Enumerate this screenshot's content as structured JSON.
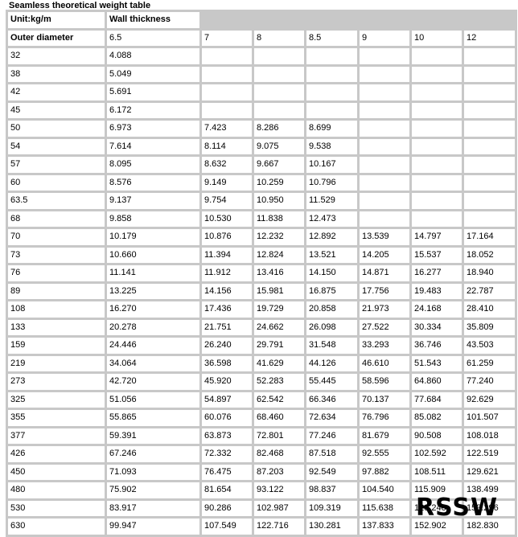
{
  "title": "Seamless theoretical weight table",
  "header": {
    "unit_label": "Unit:kg/m",
    "wall_label": "Wall thickness",
    "outer_label": "Outer diameter",
    "wall_values": [
      "6.5",
      "7",
      "8",
      "8.5",
      "9",
      "10",
      "12"
    ]
  },
  "rows": [
    {
      "od": "32",
      "v": [
        "4.088",
        "",
        "",
        "",
        "",
        "",
        ""
      ]
    },
    {
      "od": "38",
      "v": [
        "5.049",
        "",
        "",
        "",
        "",
        "",
        ""
      ]
    },
    {
      "od": "42",
      "v": [
        "5.691",
        "",
        "",
        "",
        "",
        "",
        ""
      ]
    },
    {
      "od": "45",
      "v": [
        "6.172",
        "",
        "",
        "",
        "",
        "",
        ""
      ]
    },
    {
      "od": "50",
      "v": [
        "6.973",
        "7.423",
        "8.286",
        "8.699",
        "",
        "",
        ""
      ]
    },
    {
      "od": "54",
      "v": [
        "7.614",
        "8.114",
        "9.075",
        "9.538",
        "",
        "",
        ""
      ]
    },
    {
      "od": "57",
      "v": [
        "8.095",
        "8.632",
        "9.667",
        "10.167",
        "",
        "",
        ""
      ]
    },
    {
      "od": "60",
      "v": [
        "8.576",
        "9.149",
        "10.259",
        "10.796",
        "",
        "",
        ""
      ]
    },
    {
      "od": "63.5",
      "v": [
        "9.137",
        "9.754",
        "10.950",
        "11.529",
        "",
        "",
        ""
      ]
    },
    {
      "od": "68",
      "v": [
        "9.858",
        "10.530",
        "11.838",
        "12.473",
        "",
        "",
        ""
      ]
    },
    {
      "od": "70",
      "v": [
        "10.179",
        "10.876",
        "12.232",
        "12.892",
        "13.539",
        "14.797",
        "17.164"
      ]
    },
    {
      "od": "73",
      "v": [
        "10.660",
        "11.394",
        "12.824",
        "13.521",
        "14.205",
        "15.537",
        "18.052"
      ]
    },
    {
      "od": "76",
      "v": [
        "11.141",
        "11.912",
        "13.416",
        "14.150",
        "14.871",
        "16.277",
        "18.940"
      ]
    },
    {
      "od": "89",
      "v": [
        "13.225",
        "14.156",
        "15.981",
        "16.875",
        "17.756",
        "19.483",
        "22.787"
      ]
    },
    {
      "od": "108",
      "v": [
        "16.270",
        "17.436",
        "19.729",
        "20.858",
        "21.973",
        "24.168",
        "28.410"
      ]
    },
    {
      "od": "133",
      "v": [
        "20.278",
        "21.751",
        "24.662",
        "26.098",
        "27.522",
        "30.334",
        "35.809"
      ]
    },
    {
      "od": "159",
      "v": [
        "24.446",
        "26.240",
        "29.791",
        "31.548",
        "33.293",
        "36.746",
        "43.503"
      ]
    },
    {
      "od": "219",
      "v": [
        "34.064",
        "36.598",
        "41.629",
        "44.126",
        "46.610",
        "51.543",
        "61.259"
      ]
    },
    {
      "od": "273",
      "v": [
        "42.720",
        "45.920",
        "52.283",
        "55.445",
        "58.596",
        "64.860",
        "77.240"
      ]
    },
    {
      "od": "325",
      "v": [
        "51.056",
        "54.897",
        "62.542",
        "66.346",
        "70.137",
        "77.684",
        "92.629"
      ]
    },
    {
      "od": "355",
      "v": [
        "55.865",
        "60.076",
        "68.460",
        "72.634",
        "76.796",
        "85.082",
        "101.507"
      ]
    },
    {
      "od": "377",
      "v": [
        "59.391",
        "63.873",
        "72.801",
        "77.246",
        "81.679",
        "90.508",
        "108.018"
      ]
    },
    {
      "od": "426",
      "v": [
        "67.246",
        "72.332",
        "82.468",
        "87.518",
        "92.555",
        "102.592",
        "122.519"
      ]
    },
    {
      "od": "450",
      "v": [
        "71.093",
        "76.475",
        "87.203",
        "92.549",
        "97.882",
        "108.511",
        "129.621"
      ]
    },
    {
      "od": "480",
      "v": [
        "75.902",
        "81.654",
        "93.122",
        "98.837",
        "104.540",
        "115.909",
        "138.499"
      ]
    },
    {
      "od": "530",
      "v": [
        "83.917",
        "90.286",
        "102.987",
        "109.319",
        "115.638",
        "128.240",
        "153.296"
      ]
    },
    {
      "od": "630",
      "v": [
        "99.947",
        "107.549",
        "122.716",
        "130.281",
        "137.833",
        "152.902",
        "182.830"
      ]
    }
  ],
  "watermark": "RSSW"
}
